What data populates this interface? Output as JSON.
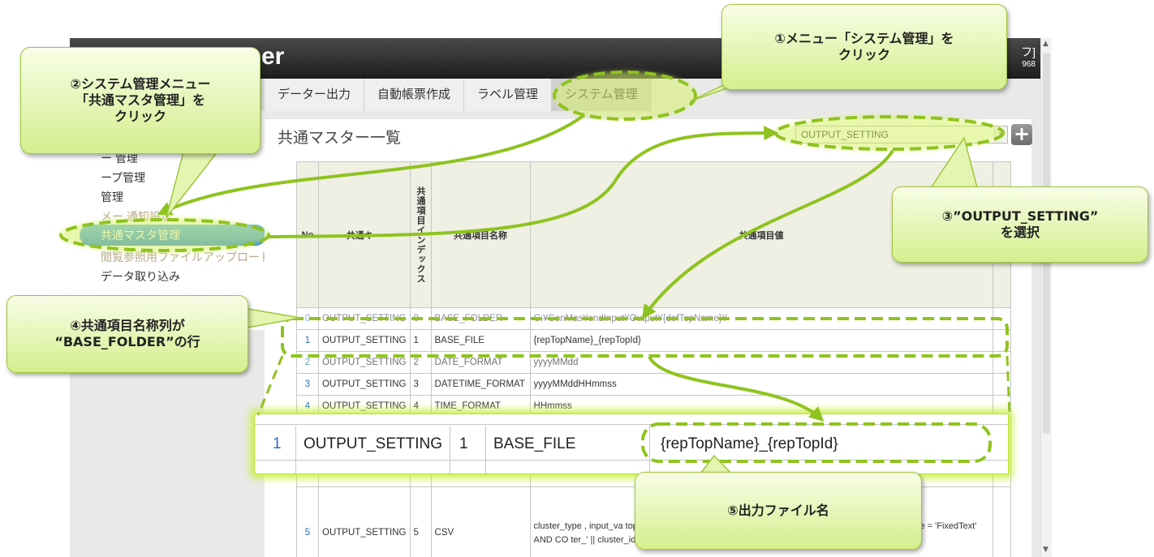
{
  "app": {
    "title_fragment": "er",
    "user_line1": "フ]",
    "user_line2": "968"
  },
  "tabs": [
    {
      "label": "データー出力"
    },
    {
      "label": "自動帳票作成"
    },
    {
      "label": "ラベル管理"
    },
    {
      "label": "システム管理",
      "active": true
    }
  ],
  "sidebar": {
    "items": [
      {
        "label": "ー 管理"
      },
      {
        "label": "ープ管理"
      },
      {
        "label": "管理"
      },
      {
        "label": "メー 通知設定"
      },
      {
        "label": "共通マスタ管理",
        "active": true
      },
      {
        "label": "閲覧参照用ファイルアップロード"
      },
      {
        "label": "データ取り込み"
      }
    ]
  },
  "main": {
    "title": "共通マスター一覧",
    "select_value": "OUTPUT_SETTING",
    "add_icon": "plus-icon"
  },
  "table": {
    "headers": {
      "no": "No",
      "key": "共通キー",
      "index": "共通項目インデックス",
      "name": "共通項目名称",
      "value": "共通項目値"
    },
    "rows": [
      {
        "no": "0",
        "key": "OUTPUT_SETTING",
        "index": "0",
        "name": "BASE_FOLDER",
        "value": "C:¥ConMas¥endInput¥Output¥{defTopName}¥"
      },
      {
        "no": "1",
        "key": "OUTPUT_SETTING",
        "index": "1",
        "name": "BASE_FILE",
        "value": "{repTopName}_{repTopId}"
      },
      {
        "no": "2",
        "key": "OUTPUT_SETTING",
        "index": "2",
        "name": "DATE_FORMAT",
        "value": "yyyyMMdd"
      },
      {
        "no": "3",
        "key": "OUTPUT_SETTING",
        "index": "3",
        "name": "DATETIME_FORMAT",
        "value": "yyyyMMddHHmmss"
      },
      {
        "no": "4",
        "key": "OUTPUT_SETTING",
        "index": "4",
        "name": "TIME_FORMAT",
        "value": "HHmmss"
      },
      {
        "no": "5",
        "key": "OUTPUT_SETTING",
        "index": "5",
        "name": "CSV",
        "value": "cluster_type , input_va                                          top_id , rep_sheet_no , cluster                                          e WHEN 'FixedText' THEN displ                                        cluster_type = 'FixedText' AND CO                                        ter_' || cluster_id || '.png' WH                                        > '' THEN"
      }
    ]
  },
  "zoom": {
    "no": "1",
    "key": "OUTPUT_SETTING",
    "index": "1",
    "name": "BASE_FILE",
    "value": "{repTopName}_{repTopId}"
  },
  "callouts": {
    "c1_line1": "①メニュー「システム管理」を",
    "c1_line2": "クリック",
    "c2_line1": "②システム管理メニュー",
    "c2_line2": "「共通マスタ管理」を",
    "c2_line3": "クリック",
    "c3_line1": "③”OUTPUT_SETTING”",
    "c3_line2": "を選択",
    "c4_line1": "④共通項目名称列が",
    "c4_line2": "“BASE_FOLDER”の行",
    "c5_line1": "⑤出力ファイル名"
  },
  "colors": {
    "accent_green": "#8fc31f",
    "callout_fill": "#d4ef8d",
    "active_blue": "#1f7ee0"
  }
}
